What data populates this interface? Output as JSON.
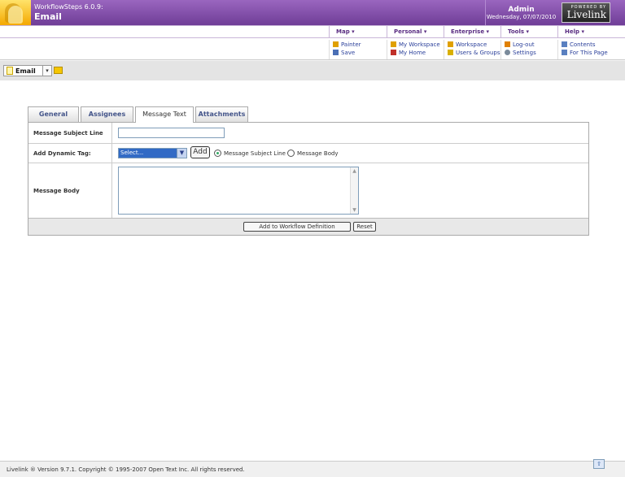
{
  "header": {
    "app_name": "WorkflowSteps 6.0.9:",
    "page_name": "Email",
    "user": "Admin",
    "date": "Wednesday, 07/07/2010",
    "brand_pre": "POWERED BY",
    "brand_name": "Livelink"
  },
  "menus": [
    {
      "title": "Map ▾",
      "items": [
        {
          "label": "Painter",
          "icon": "painter-icon"
        },
        {
          "label": "Save",
          "icon": "save-icon"
        }
      ]
    },
    {
      "title": "Personal ▾",
      "items": [
        {
          "label": "My Workspace",
          "icon": "workspace-icon"
        },
        {
          "label": "My Home",
          "icon": "home-icon"
        }
      ]
    },
    {
      "title": "Enterprise ▾",
      "items": [
        {
          "label": "Workspace",
          "icon": "enterprise-workspace-icon"
        },
        {
          "label": "Users & Groups",
          "icon": "users-groups-icon"
        }
      ]
    },
    {
      "title": "Tools ▾",
      "items": [
        {
          "label": "Log-out",
          "icon": "logout-icon"
        },
        {
          "label": "Settings",
          "icon": "settings-icon"
        }
      ]
    },
    {
      "title": "Help ▾",
      "items": [
        {
          "label": "Contents",
          "icon": "contents-icon"
        },
        {
          "label": "For This Page",
          "icon": "help-page-icon"
        }
      ]
    }
  ],
  "breadcrumb": {
    "label": "Email",
    "menu_glyph": "▾"
  },
  "tabs": [
    "General",
    "Assignees",
    "Message Text",
    "Attachments"
  ],
  "active_tab": "Message Text",
  "form": {
    "subject_label": "Message Subject Line",
    "subject_value": "",
    "tag_label": "Add Dynamic Tag:",
    "tag_select_value": "Select...",
    "add_label": "Add",
    "radio_subject": "Message Subject Line",
    "radio_body": "Message Body",
    "radio_selected": "subject",
    "body_label": "Message Body",
    "body_value": ""
  },
  "buttons": {
    "add_to_workflow": "Add to Workflow Definition",
    "reset": "Reset"
  },
  "footer": {
    "text": "Livelink ® Version 9.7.1. Copyright © 1995-2007 Open Text Inc. All rights reserved.",
    "top_glyph": "⇧"
  },
  "colors": {
    "header_purple": "#7a46a0",
    "menu_title": "#5a2d82",
    "link_blue": "#2a3f9a"
  }
}
